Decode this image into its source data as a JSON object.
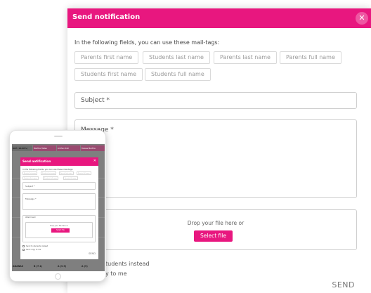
{
  "modal": {
    "title": "Send notification",
    "close_icon": "✕",
    "intro": "In the following fields, you can use these mail-tags:",
    "tags": [
      "Parents first name",
      "Students last name",
      "Parents last name",
      "Parents full name",
      "Students first name",
      "Students full name"
    ],
    "subject_label": "Subject *",
    "message_label": "Message *",
    "drop_text": "Drop your file here or",
    "select_file": "Select file",
    "checkbox_1": "tudents instead",
    "checkbox_2": "y to me",
    "send": "SEND",
    "accent_color": "#e8177f"
  },
  "phone": {
    "table_headers": [
      "ACE (10.00%)",
      "Martha Hatsu",
      "Anthon Kim",
      "Teresa Martha"
    ],
    "bottom_cells": [
      "ANANAS",
      "B (7.1)",
      "A (9.9)",
      "A (9)"
    ],
    "modal": {
      "title": "Send notification",
      "close_icon": "✕",
      "intro": "In the following fields, you can use these mail-tags:",
      "tags": [
        "Parents first name",
        "Students last name",
        "Parents last name",
        "Parents full name",
        "Students first name",
        "Students full name",
        "Parents full name"
      ],
      "subject_label": "Subject *",
      "message_label": "Message *",
      "attachment_label": "Attachment",
      "drop_text": "Drop your file here or",
      "select_file": "Select file",
      "checkbox_1": "Send to students instead",
      "checkbox_2": "Send copy to me",
      "send": "SEND"
    }
  }
}
